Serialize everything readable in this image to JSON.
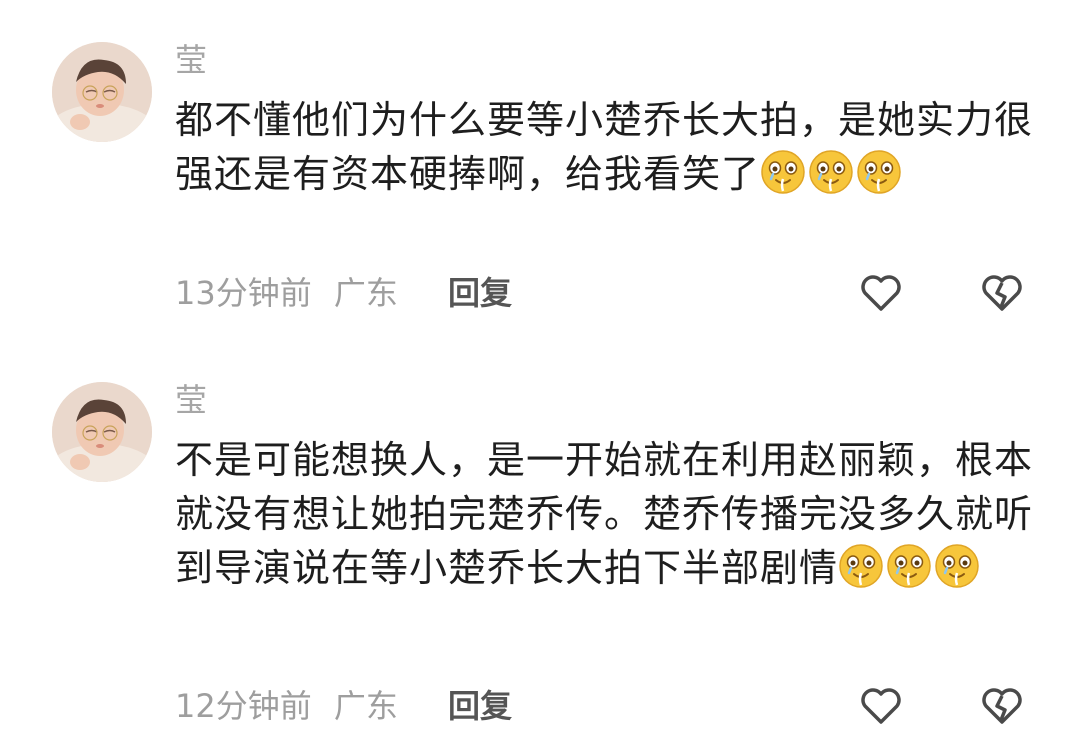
{
  "comments": [
    {
      "username": "莹",
      "text": "都不懂他们为什么要等小楚乔长大拍，是她实力很强还是有资本硬捧啊，给我看笑了",
      "emoji_count": 3,
      "time": "13分钟前",
      "location": "广东",
      "reply_label": "回复"
    },
    {
      "username": "莹",
      "text": "不是可能想换人，是一开始就在利用赵丽颖，根本就没有想让她拍完楚乔传。楚乔传播完没多久就听到导演说在等小楚乔长大拍下半部剧情",
      "emoji_count": 3,
      "time": "12分钟前",
      "location": "广东",
      "reply_label": "回复"
    }
  ],
  "icons": {
    "like": "heart-outline-icon",
    "dislike": "broken-heart-outline-icon",
    "emoji": "crying-laughing-face-icon"
  },
  "colors": {
    "username": "#a6a6a6",
    "text": "#1e1e1e",
    "meta": "#9e9e9e",
    "emoji": "#f7c63b"
  }
}
